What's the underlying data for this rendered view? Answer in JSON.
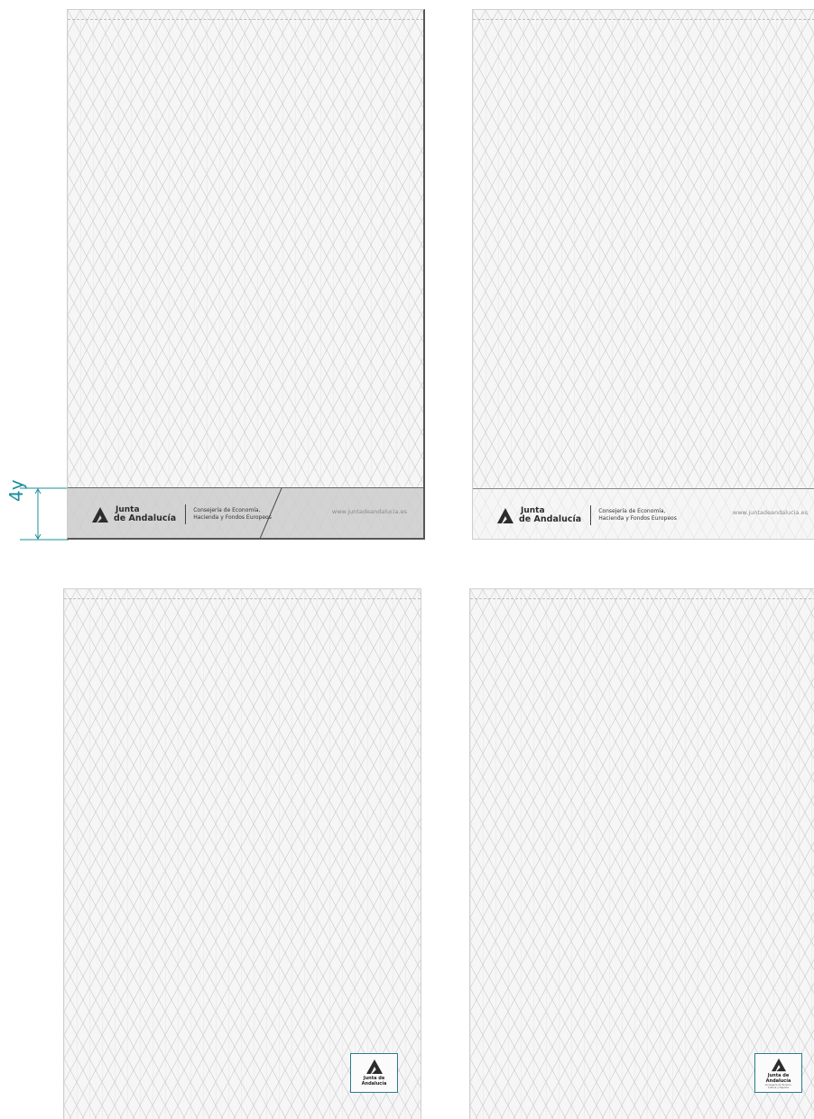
{
  "dimension": {
    "label": "4y",
    "color": "#1b8f9a"
  },
  "footer": {
    "brand_line1": "Junta",
    "brand_line2": "de Andalucía",
    "dept_line1": "Consejería de Economía,",
    "dept_line2": "Hacienda y Fondos Europeos",
    "url": "www.juntadeandalucia.es"
  },
  "square_logo": {
    "name": "Junta de Andalucía",
    "sub_line1": "Consejería de Turismo,",
    "sub_line2": "Cultura y Deporte",
    "border_color": "#2a7e8c"
  },
  "colors": {
    "accent_red": "#e03a2a",
    "grid": "#c9c9c9"
  }
}
